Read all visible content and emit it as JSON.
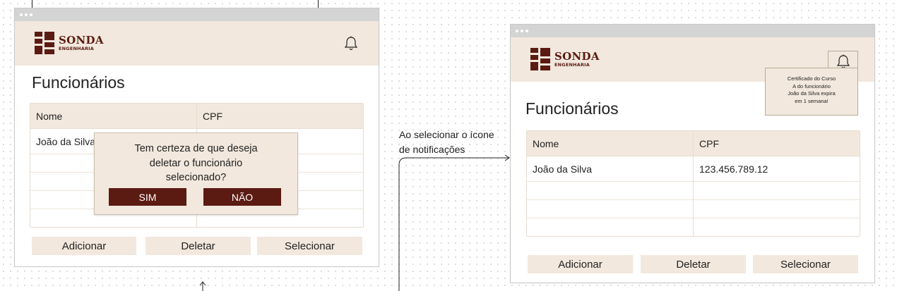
{
  "logo": {
    "line1": "SONDA",
    "line2": "ENGENHARIA"
  },
  "left_window": {
    "title": "Funcionários",
    "columns": [
      "Nome",
      "CPF"
    ],
    "rows": [
      [
        "João da Silva",
        ""
      ],
      [
        "",
        ""
      ],
      [
        "",
        ""
      ],
      [
        "",
        ""
      ],
      [
        "",
        ""
      ]
    ],
    "buttons": {
      "add": "Adicionar",
      "delete": "Deletar",
      "select": "Selecionar"
    },
    "dialog": {
      "line1": "Tem certeza de que deseja",
      "line2": "deletar o funcionário",
      "line3": "selecionado?",
      "yes": "SIM",
      "no": "NÃO"
    }
  },
  "annotation": {
    "line1": "Ao selecionar o ícone",
    "line2": "de notificações"
  },
  "right_window": {
    "title": "Funcionários",
    "columns": [
      "Nome",
      "CPF"
    ],
    "rows": [
      [
        "João da Silva",
        "123.456.789.12"
      ],
      [
        "",
        ""
      ],
      [
        "",
        ""
      ],
      [
        "",
        ""
      ]
    ],
    "buttons": {
      "add": "Adicionar",
      "delete": "Deletar",
      "select": "Selecionar"
    },
    "notification": {
      "line1": "Certificado do Curso",
      "line2": "A do funcionário",
      "line3": "João da Silva expira",
      "line4": "em 1 semana!"
    }
  },
  "colors": {
    "brand": "#5b1a12",
    "beige": "#f2e8dd",
    "titlebar": "#d4d4d4"
  },
  "icons": [
    "bell-icon",
    "logo-mark-icon",
    "arrow-right-icon",
    "arrow-up-icon"
  ]
}
